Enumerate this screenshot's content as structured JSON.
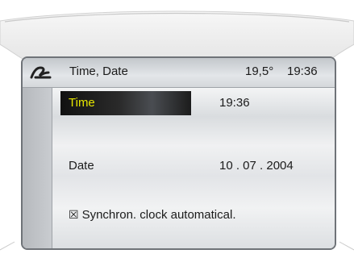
{
  "header": {
    "title": "Time, Date",
    "temperature": "19,5°",
    "clock": "19:36"
  },
  "rows": [
    {
      "label": "Time",
      "value": "19:36",
      "selected": true
    },
    {
      "label": "Date",
      "value": "10 . 07 . 2004",
      "selected": false
    }
  ],
  "options": {
    "sync_checkbox_symbol": "☒",
    "sync_label": "Synchron. clock automatical."
  },
  "colors": {
    "selected_text": "#e6e600",
    "highlight": "#111111"
  },
  "icons": {
    "logo": "car-logo-icon"
  }
}
